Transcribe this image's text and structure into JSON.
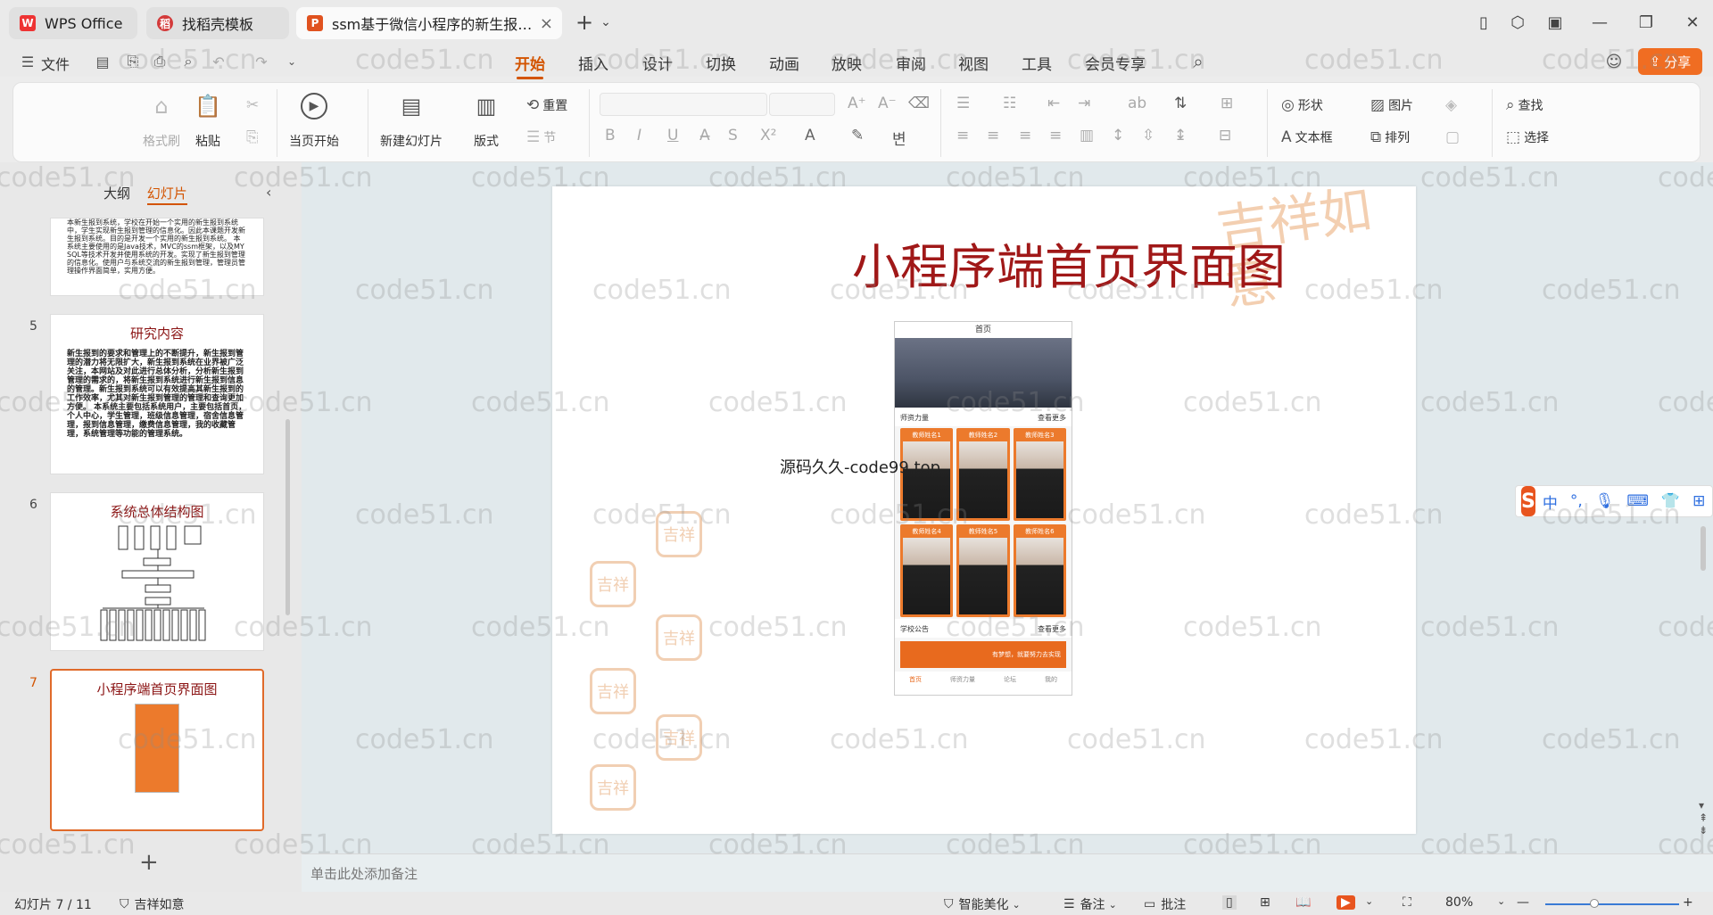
{
  "titlebar": {
    "tabs": [
      {
        "label": "WPS Office",
        "icon": "wps-logo-icon"
      },
      {
        "label": "找稻壳模板",
        "icon": "docer-icon"
      },
      {
        "label": "ssm基于微信小程序的新生报…",
        "icon": "presentation-icon"
      }
    ],
    "new_tab": "+",
    "dropdown": "⌄"
  },
  "menu": {
    "file": "文件",
    "items": [
      "开始",
      "插入",
      "设计",
      "切换",
      "动画",
      "放映",
      "审阅",
      "视图",
      "工具",
      "会员专享"
    ],
    "active": "开始",
    "share": "分享"
  },
  "ribbon": {
    "format_painter": "格式刷",
    "paste": "粘贴",
    "start_from_current": "当页开始",
    "new_slide": "新建幻灯片",
    "layout": "版式",
    "reset": "重置",
    "section": "节",
    "shape": "形状",
    "picture": "图片",
    "textbox": "文本框",
    "arrange": "排列",
    "find": "查找",
    "select": "选择"
  },
  "panel": {
    "tabs": [
      "大纲",
      "幻灯片"
    ],
    "active_tab": "幻灯片",
    "slides": [
      {
        "num": "",
        "title": "",
        "body": "本新生报到系统，学校在开始一个实用的新生报到系统中，学生实现新生报到管理的信息化。因此本课题开发新生报到系统。目的是开发一个实用的新生报到系统。 本系统主要使用的是Java技术，MVC的ssm框架，以及MYSQL等技术开发并使用系统的开发。实现了新生报到管理的信息化。使用户与系统交流的新生报到管理，管理员管理操作界面简单，实用方便。"
      },
      {
        "num": "5",
        "title": "研究内容",
        "body": "新生报到的要求和管理上的不断提升，新生报到管理的潜力将无限扩大，新生报到系统在业界被广泛关注，本网站及对此进行总体分析，分析新生报到管理的需求的，将新生报到系统进行新生报到信息的管理。新生报到系统可以有效提高其新生报到的工作效率，尤其对新生报到管理的管理和查询更加方便。 本系统主要包括系统用户，主要包括首页，个人中心，学生管理，班级信息管理，宿舍信息管理，报到信息管理，缴费信息管理，我的收藏管理，系统管理等功能的管理系统。"
      },
      {
        "num": "6",
        "title": "系统总体结构图",
        "body": ""
      },
      {
        "num": "7",
        "title": "小程序端首页界面图",
        "body": ""
      }
    ],
    "add": "+"
  },
  "slide": {
    "title": "小程序端首页界面图",
    "watermark_text": "源码久久-code99.top",
    "deco_text": "吉祥如意",
    "seal_text": "吉祥",
    "phone": {
      "header": "首页",
      "section1": "师资力量",
      "more1": "查看更多",
      "cards": [
        "教师姓名1",
        "教师姓名2",
        "教师姓名3",
        "教师姓名4",
        "教师姓名5",
        "教师姓名6"
      ],
      "section2": "学校公告",
      "more2": "查看更多",
      "news": "有梦想，就要努力去实现",
      "nav": [
        "首页",
        "师资力量",
        "论坛",
        "我的"
      ]
    }
  },
  "notes": {
    "placeholder": "单击此处添加备注"
  },
  "status": {
    "slide_info": "幻灯片 7 / 11",
    "theme": "吉祥如意",
    "beautify": "智能美化",
    "notes": "备注",
    "comments": "批注",
    "zoom": "80%"
  },
  "ime": {
    "mode": "中",
    "punct": "°,"
  },
  "watermark": "code51.cn",
  "colors": {
    "accent": "#d35400",
    "share": "#f06d22",
    "title_red": "#a01818"
  }
}
